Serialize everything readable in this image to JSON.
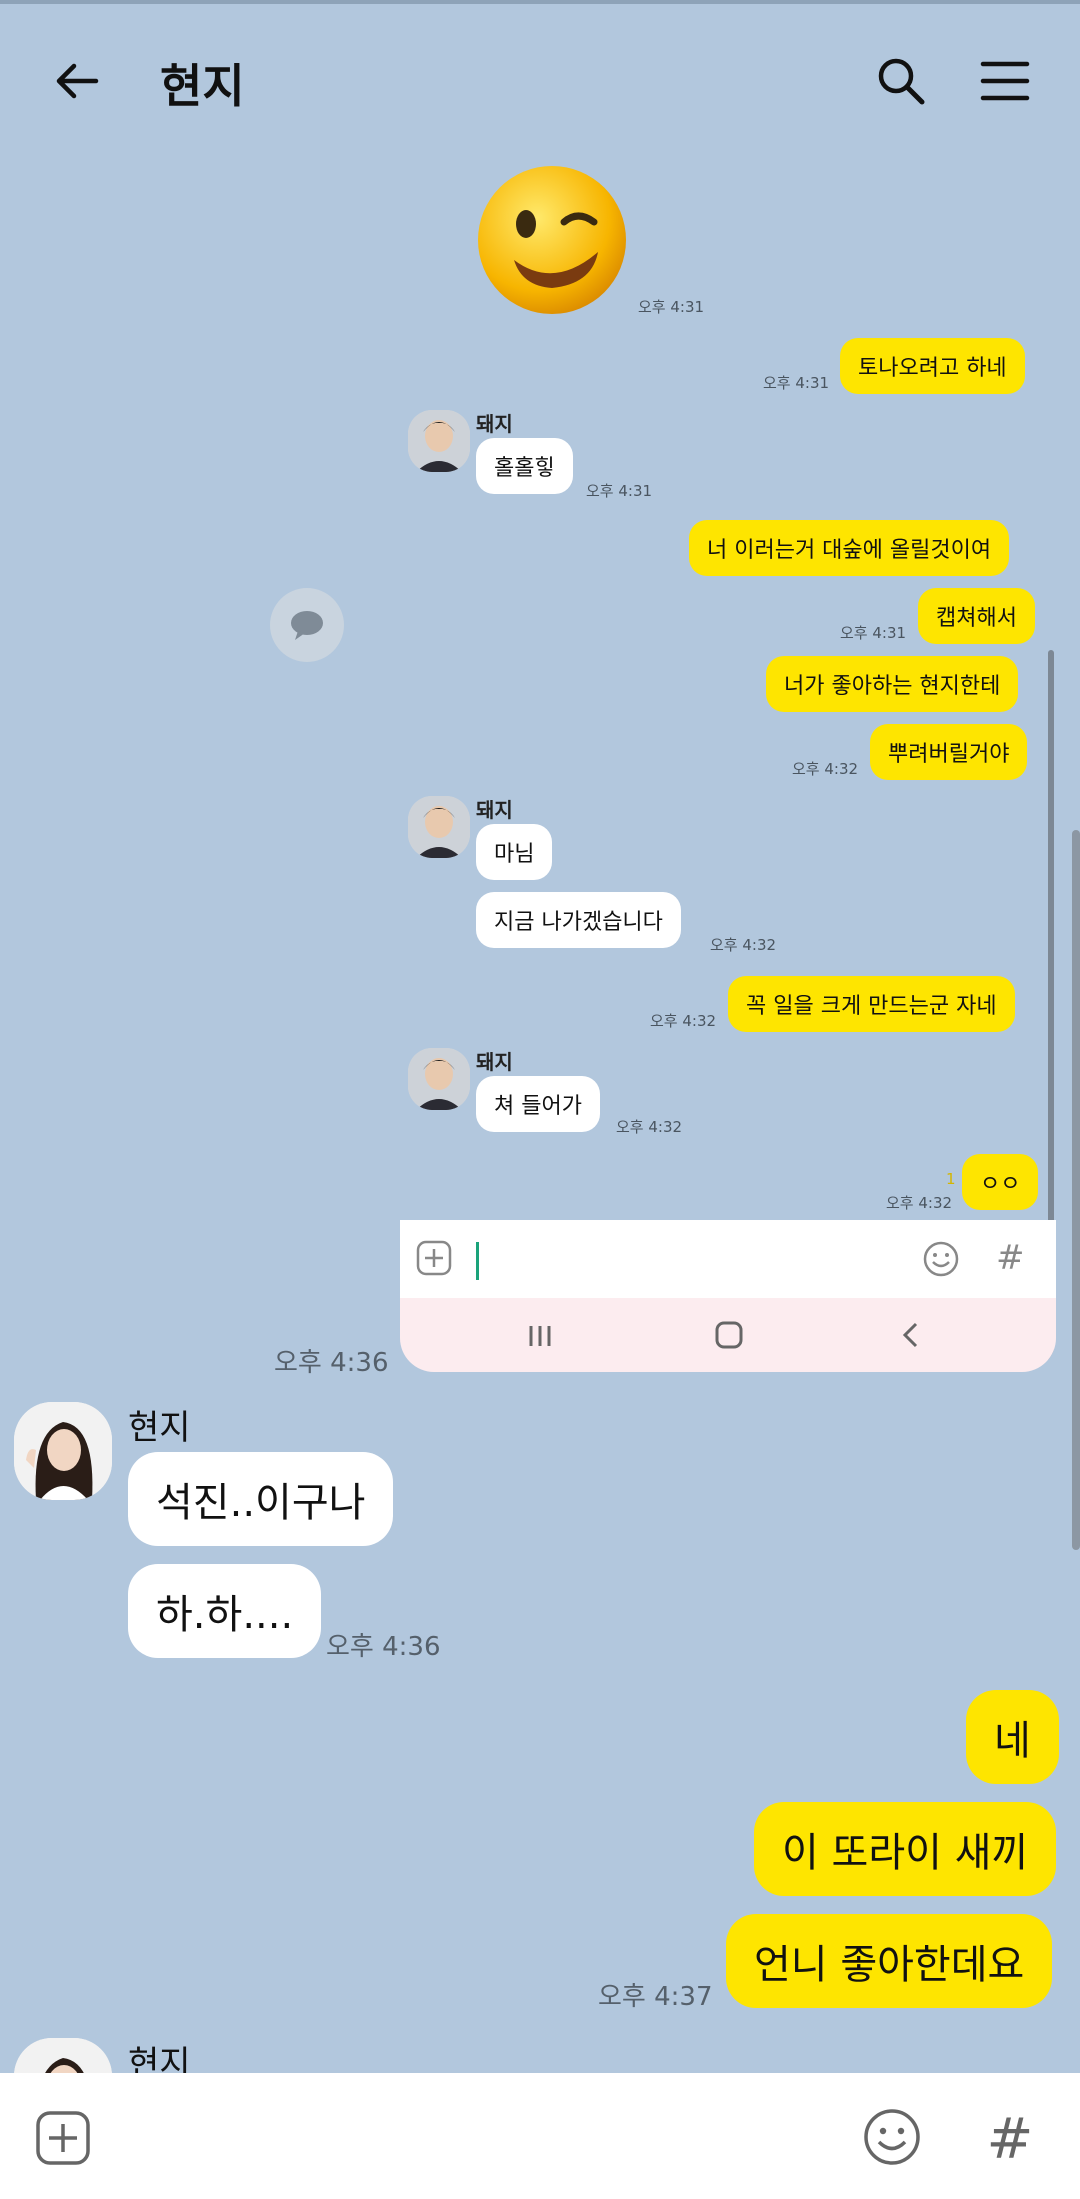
{
  "header": {
    "title": "현지",
    "back_icon": "back-arrow-icon",
    "search_icon": "search-icon",
    "menu_icon": "menu-icon"
  },
  "shared_screenshot": {
    "emoticon": "wink-emoticon",
    "emoticon_time": "오후 4:31",
    "messages": [
      {
        "from": "me",
        "text": "토나오려고 하네",
        "time": "오후 4:31"
      },
      {
        "from": "friend",
        "name": "돼지",
        "text": "홀홀힣",
        "time": "오후 4:31"
      },
      {
        "from": "me",
        "text": "너 이러는거 대숲에 올릴것이여"
      },
      {
        "from": "me",
        "text": "캡쳐해서",
        "time": "오후 4:31"
      },
      {
        "from": "me",
        "text": "너가 좋아하는 현지한테"
      },
      {
        "from": "me",
        "text": "뿌려버릴거야",
        "time": "오후 4:32"
      },
      {
        "from": "friend",
        "name": "돼지",
        "text": "마님"
      },
      {
        "from": "friend",
        "text": "지금 나가겠습니다",
        "time": "오후 4:32"
      },
      {
        "from": "me",
        "text": "꼭 일을 크게 만드는군 자네",
        "time": "오후 4:32"
      },
      {
        "from": "friend",
        "name": "돼지",
        "text": "쳐 들어가",
        "time": "오후 4:32"
      },
      {
        "from": "me",
        "text": "ㅇㅇ",
        "time": "오후 4:32",
        "unread": "1"
      }
    ],
    "image_time": "오후 4:36"
  },
  "chat": [
    {
      "from": "friend",
      "name": "현지",
      "text": "석진..이구나"
    },
    {
      "from": "friend",
      "text": "하.하....",
      "time": "오후 4:36"
    },
    {
      "from": "me",
      "text": "네"
    },
    {
      "from": "me",
      "text": "이 또라이 새끼"
    },
    {
      "from": "me",
      "text": "언니 좋아한데요",
      "time": "오후 4:37"
    },
    {
      "from": "friend",
      "name": "현지"
    }
  ],
  "input_bar": {
    "plus_icon": "plus-icon",
    "emoji_icon": "emoji-icon",
    "hash_icon": "hashtag-icon"
  },
  "colors": {
    "background": "#b2c7dd",
    "my_bubble": "#fee500",
    "friend_bubble": "#ffffff"
  }
}
